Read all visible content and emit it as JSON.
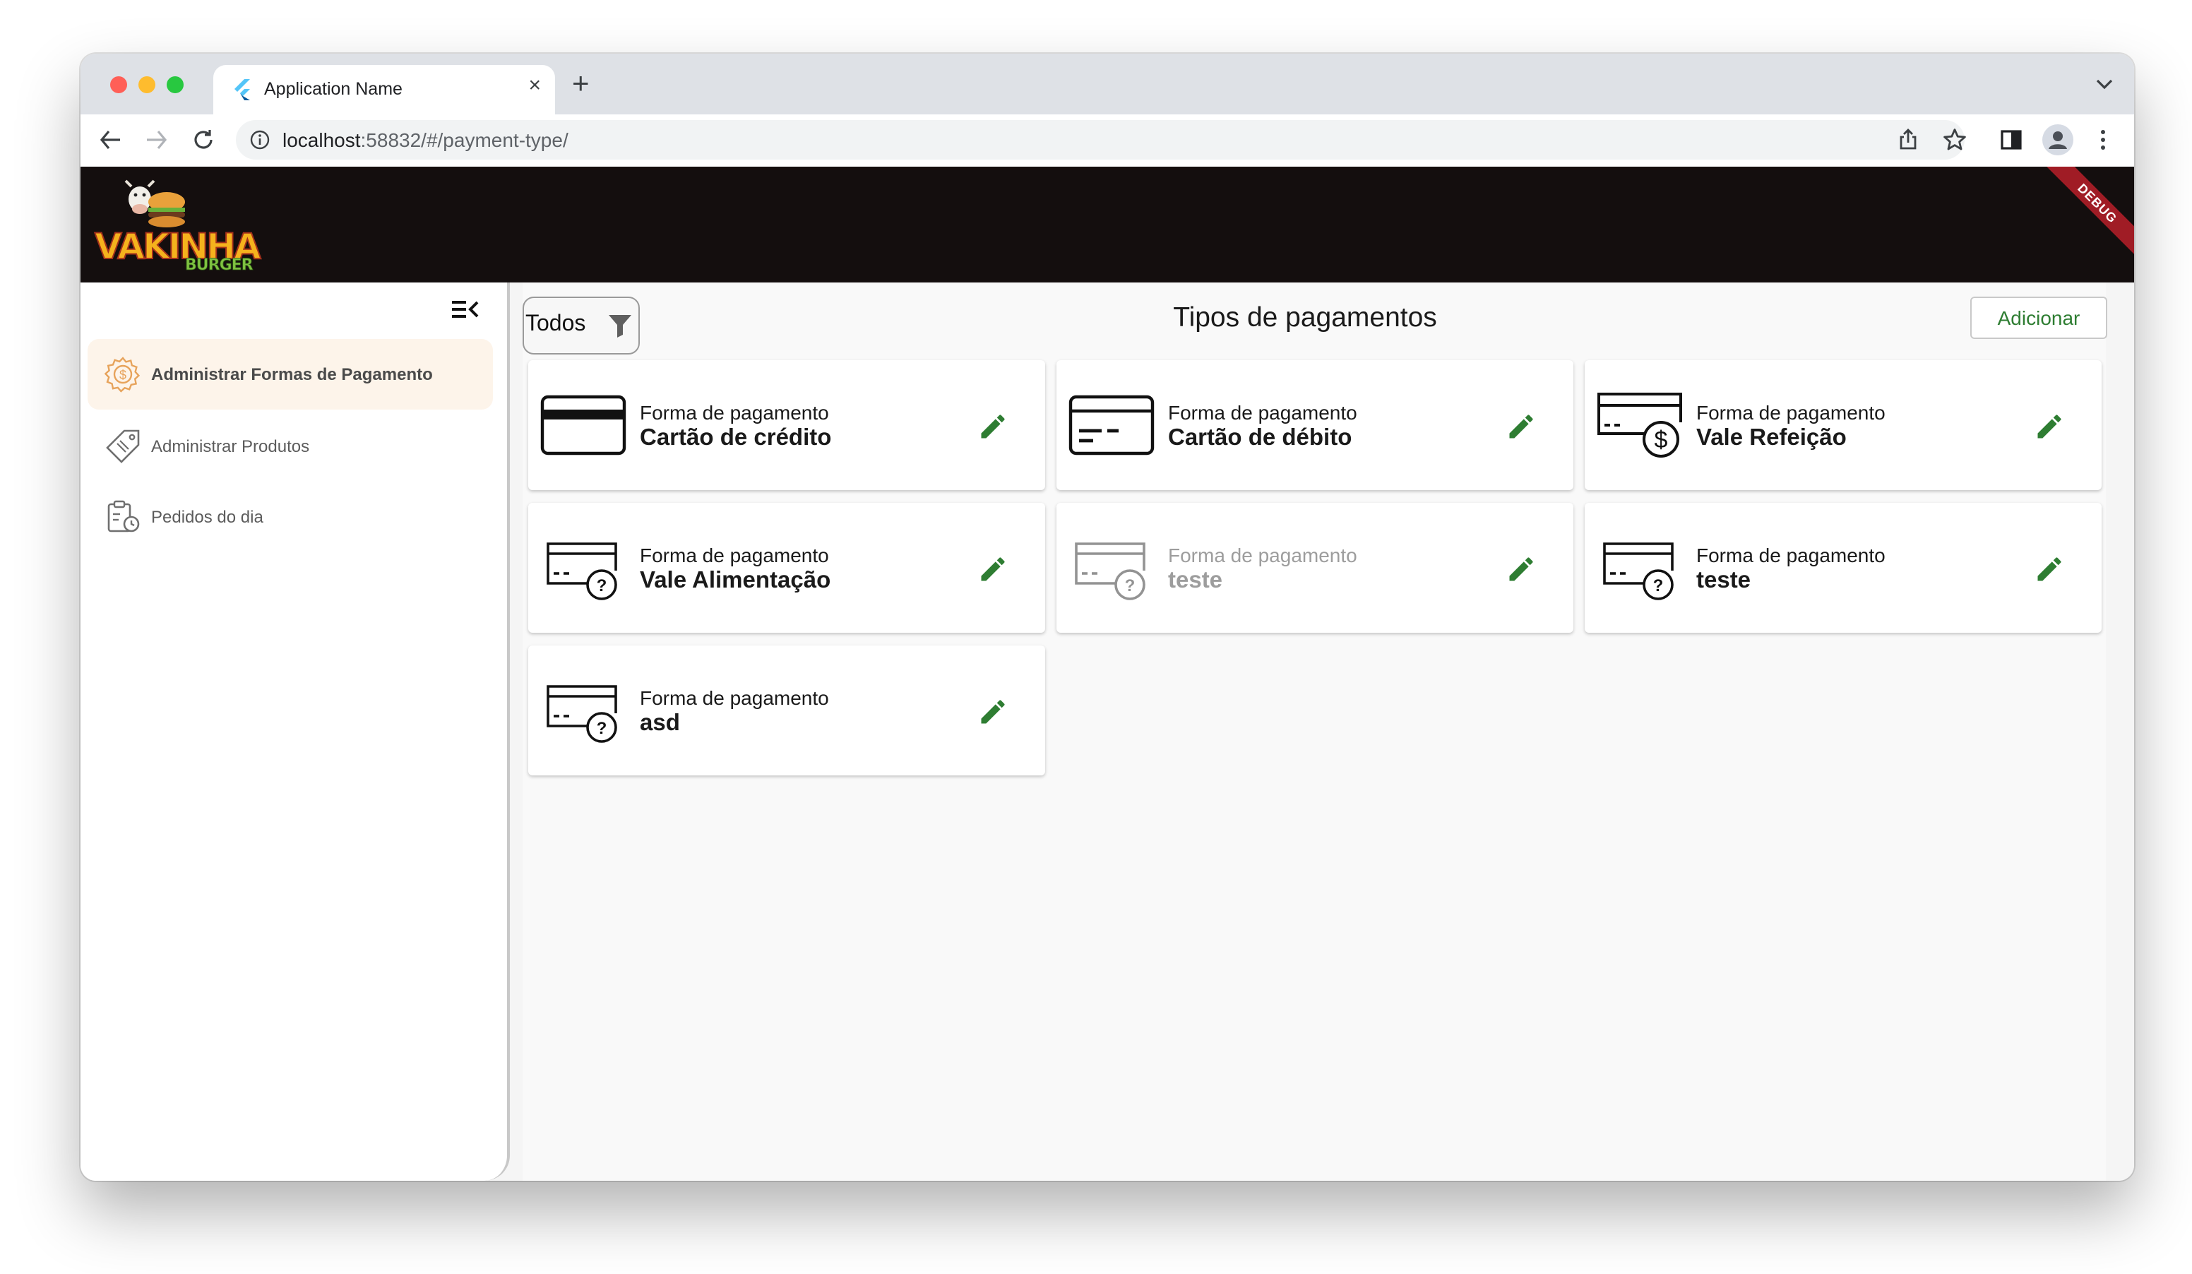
{
  "browser": {
    "tab_title": "Application Name",
    "new_tab": "+",
    "close_tab": "×",
    "url_host": "localhost",
    "url_path": ":58832/#/payment-type/"
  },
  "app": {
    "logo_text": "VAKINHA",
    "logo_subtext": "BURGER",
    "debug_banner": "DEBUG"
  },
  "sidebar": {
    "items": [
      {
        "label": "Administrar Formas de Pagamento",
        "icon": "payment-settings-icon",
        "active": true
      },
      {
        "label": "Administrar Produtos",
        "icon": "product-tag-icon",
        "active": false
      },
      {
        "label": "Pedidos do dia",
        "icon": "orders-clipboard-icon",
        "active": false
      }
    ]
  },
  "main": {
    "filter_label": "Todos",
    "title": "Tipos de pagamentos",
    "add_label": "Adicionar",
    "cards": [
      {
        "subtitle": "Forma de pagamento",
        "name": "Cartão de crédito",
        "icon": "credit-card-icon",
        "enabled": true
      },
      {
        "subtitle": "Forma de pagamento",
        "name": "Cartão de débito",
        "icon": "debit-card-icon",
        "enabled": true
      },
      {
        "subtitle": "Forma de pagamento",
        "name": "Vale Refeição",
        "icon": "card-dollar-icon",
        "enabled": true
      },
      {
        "subtitle": "Forma de pagamento",
        "name": "Vale Alimentação",
        "icon": "card-question-icon",
        "enabled": true
      },
      {
        "subtitle": "Forma de pagamento",
        "name": "teste",
        "icon": "card-question-icon",
        "enabled": false
      },
      {
        "subtitle": "Forma de pagamento",
        "name": "teste",
        "icon": "card-question-icon",
        "enabled": true
      },
      {
        "subtitle": "Forma de pagamento",
        "name": "asd",
        "icon": "card-question-icon",
        "enabled": true
      }
    ]
  },
  "colors": {
    "accent_green": "#2e7d32",
    "appbar": "#140e0e",
    "active_menu_bg": "#fdf4ea",
    "debug_banner": "#a01c25"
  }
}
